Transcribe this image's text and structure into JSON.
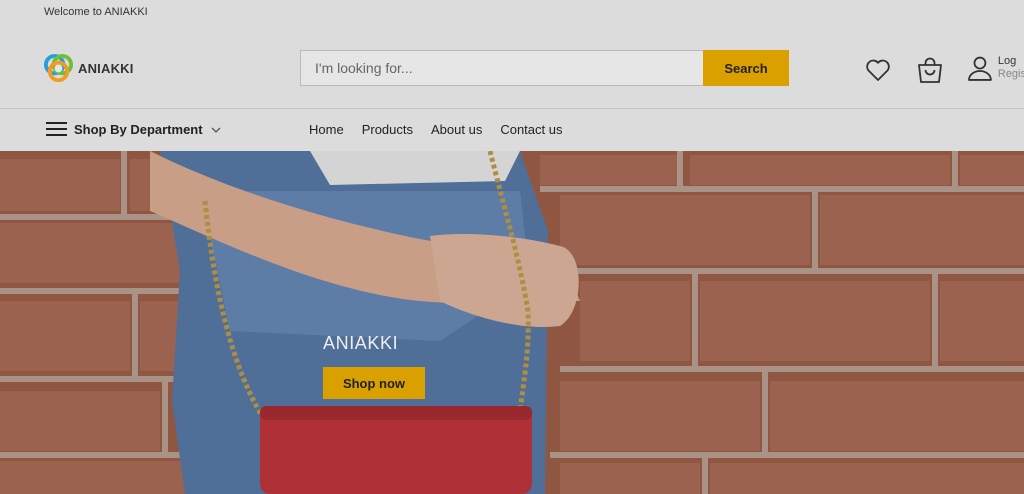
{
  "topbar": {
    "welcome": "Welcome to ANIAKKI"
  },
  "header": {
    "logo_text": "ANIAKKI",
    "search": {
      "placeholder": "I'm looking for...",
      "button": "Search"
    },
    "icons": {
      "wishlist": "heart-icon",
      "cart": "shopping-bag-icon",
      "account": "user-icon"
    },
    "account": {
      "login": "Log",
      "register": "Regis"
    }
  },
  "nav": {
    "department": "Shop By Department",
    "menu": [
      "Home",
      "Products",
      "About us",
      "Contact us"
    ]
  },
  "hero": {
    "title": "ANIAKKI",
    "button": "Shop now"
  },
  "colors": {
    "accent": "#d9a000",
    "header_bg": "#dcdcdc",
    "brick": "#9c5a42",
    "bag": "#c8383f"
  }
}
